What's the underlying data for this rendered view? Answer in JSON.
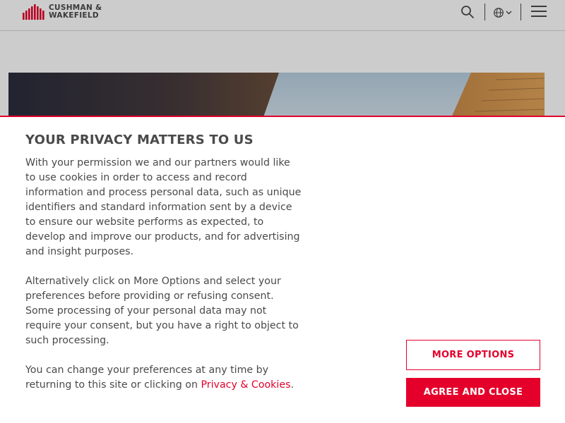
{
  "header": {
    "logo_line1": "CUSHMAN &",
    "logo_line2": "WAKEFIELD",
    "icons": [
      "search-icon",
      "globe-icon",
      "chevron-down-icon",
      "menu-icon"
    ]
  },
  "consent": {
    "title": "YOUR PRIVACY MATTERS TO US",
    "paragraph1": "With your permission we and our partners would like to use cookies in order to access and record information and process personal data, such as unique identifiers and standard information sent by a device to ensure our website performs as expected, to develop and improve our products, and for advertising and insight purposes.",
    "paragraph2": "Alternatively click on More Options and select your preferences before providing or refusing consent. Some processing of your personal data may not require your consent, but you have a right to object to such processing.",
    "paragraph3_prefix": "You can change your preferences at any time by returning to this site or clicking on ",
    "privacy_link": "Privacy & Cookies",
    "paragraph3_suffix": ".",
    "more_options_label": "MORE OPTIONS",
    "agree_label": "AGREE AND CLOSE"
  },
  "colors": {
    "brand_red": "#e4002b",
    "text_gray": "#4a4a4a"
  }
}
